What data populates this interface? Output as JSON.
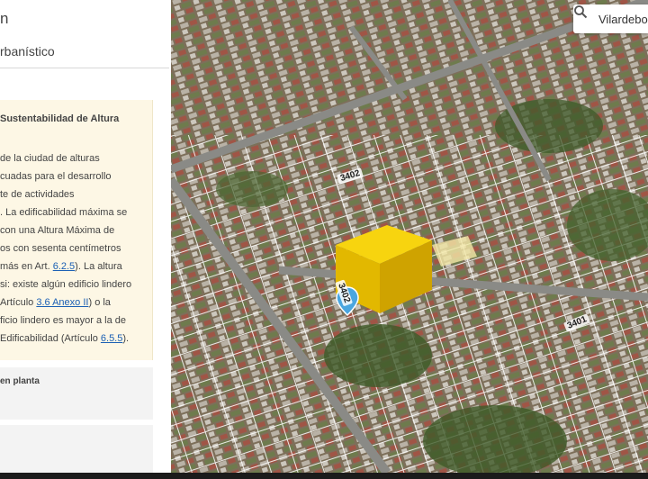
{
  "panel": {
    "title": "n",
    "subtitle": "rbanístico",
    "card": {
      "heading": "Sustentabilidad de Altura",
      "lines": [
        {
          "text": " de la ciudad de alturas"
        },
        {
          "text": "cuadas para el desarrollo"
        },
        {
          "text": "te de actividades"
        },
        {
          "text": ". La edificabilidad máxima se"
        },
        {
          "text": "con una Altura Máxima de"
        },
        {
          "text": "os con sesenta centímetros"
        },
        {
          "text": "más en Art. ",
          "link": "6.2.5",
          "after": "). La altura"
        },
        {
          "text": "si: existe algún edificio lindero"
        },
        {
          "text": "Artículo ",
          "link": "3.6 Anexo II",
          "after": ") o la"
        },
        {
          "text": "ficio lindero es mayor a la de"
        },
        {
          "text": " Edificabilidad (Artículo ",
          "link": "6.5.5",
          "after": ")."
        }
      ]
    },
    "sections": [
      {
        "label": "en planta"
      },
      {
        "label": ""
      }
    ]
  },
  "map": {
    "search": {
      "value": "Vilardebo",
      "icon": "search-icon"
    },
    "street_labels": [
      "3402",
      "3401",
      "3402"
    ],
    "colors": {
      "volume": "#f2c500",
      "marker": "#4aa6e0",
      "lot_outline": "#ffffff"
    }
  }
}
